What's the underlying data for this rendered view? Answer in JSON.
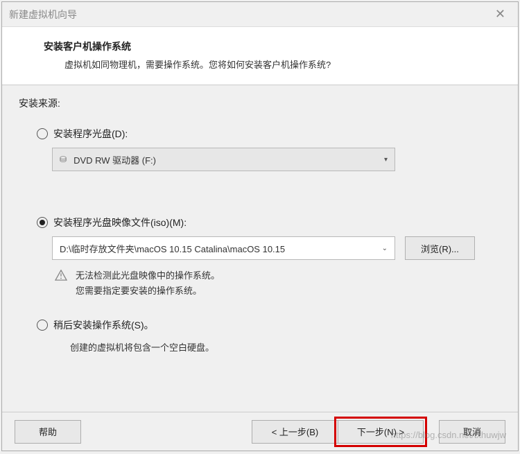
{
  "titlebar": {
    "title": "新建虚拟机向导"
  },
  "header": {
    "title": "安装客户机操作系统",
    "subtitle": "虚拟机如同物理机，需要操作系统。您将如何安装客户机操作系统?"
  },
  "source": {
    "label": "安装来源:",
    "options": {
      "disc": {
        "label": "安装程序光盘(D):",
        "dropdown_value": "DVD RW 驱动器 (F:)",
        "selected": false
      },
      "iso": {
        "label": "安装程序光盘映像文件(iso)(M):",
        "path": "D:\\临时存放文件夹\\macOS 10.15 Catalina\\macOS 10.15",
        "browse_label": "浏览(R)...",
        "selected": true,
        "warning_line1": "无法检测此光盘映像中的操作系统。",
        "warning_line2": "您需要指定要安装的操作系统。"
      },
      "later": {
        "label": "稍后安装操作系统(S)。",
        "description": "创建的虚拟机将包含一个空白硬盘。",
        "selected": false
      }
    }
  },
  "buttons": {
    "help": "帮助",
    "back": "< 上一步(B)",
    "next": "下一步(N) >",
    "cancel": "取消"
  },
  "watermark": "https://blog.csdn.net/txhuwjw"
}
